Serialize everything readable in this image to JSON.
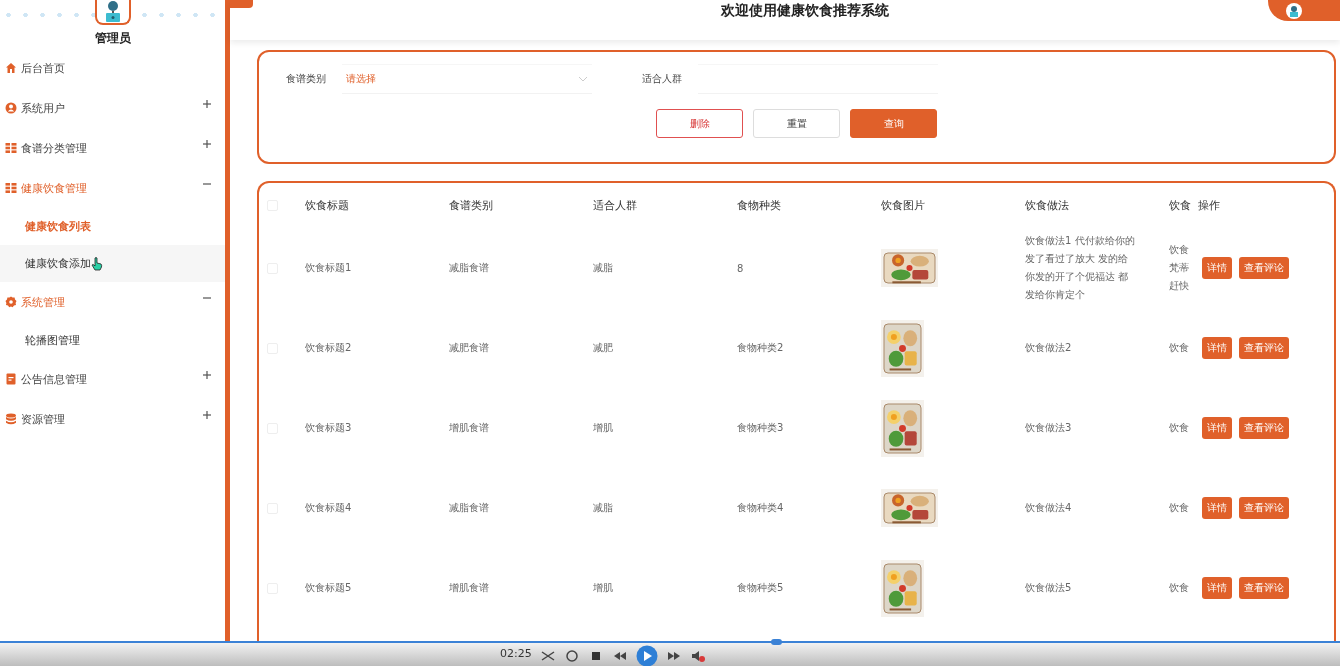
{
  "header": {
    "title": "欢迎使用健康饮食推荐系统"
  },
  "sidebar": {
    "user": "管理员",
    "items": [
      {
        "label": "后台首页",
        "kind": "home"
      },
      {
        "label": "系统用户",
        "kind": "user",
        "expanded": false
      },
      {
        "label": "食谱分类管理",
        "kind": "grid",
        "expanded": false
      },
      {
        "label": "健康饮食管理",
        "kind": "grid",
        "expanded": true,
        "children": [
          {
            "label": "健康饮食列表",
            "selected": true,
            "hovered": false
          },
          {
            "label": "健康饮食添加",
            "selected": false,
            "hovered": true
          }
        ]
      },
      {
        "label": "系统管理",
        "kind": "gear",
        "expanded": true,
        "children": [
          {
            "label": "轮播图管理",
            "selected": false,
            "hovered": false
          }
        ]
      },
      {
        "label": "公告信息管理",
        "kind": "doc",
        "expanded": false
      },
      {
        "label": "资源管理",
        "kind": "db",
        "expanded": false
      }
    ]
  },
  "search": {
    "fields": [
      {
        "kind": "select",
        "label": "食谱类别",
        "placeholder": "请选择"
      },
      {
        "kind": "input",
        "label": "适合人群"
      }
    ],
    "buttons": [
      {
        "label": "删除",
        "kind": "danger"
      },
      {
        "label": "重置",
        "kind": "default"
      },
      {
        "label": "查询",
        "kind": "primary"
      }
    ]
  },
  "table": {
    "all_checked": false,
    "columns": [
      "饮食标题",
      "食谱类别",
      "适合人群",
      "食物种类",
      "饮食图片",
      "饮食做法",
      "饮食",
      "操作"
    ],
    "rows": [
      {
        "checked": false,
        "title": "饮食标题1",
        "category": "减脂食谱",
        "crowd": "减脂",
        "food": "8",
        "picture": {
          "kind": "picture"
        },
        "method": "饮食做法1 代付款给你的发了看过了放大 发的给你发的开了个伲福达 都发给你肯定个",
        "column_7": "饮食梵蒂赶快",
        "actions": [
          "详情",
          "查看评论"
        ]
      },
      {
        "checked": false,
        "title": "饮食标题2",
        "category": "减肥食谱",
        "crowd": "减肥",
        "food": "食物种类2",
        "picture": {
          "kind": "picture"
        },
        "method": "饮食做法2",
        "column_7": "饮食",
        "actions": [
          "详情",
          "查看评论"
        ]
      },
      {
        "checked": false,
        "title": "饮食标题3",
        "category": "增肌食谱",
        "crowd": "增肌",
        "food": "食物种类3",
        "picture": {
          "kind": "picture"
        },
        "method": "饮食做法3",
        "column_7": "饮食",
        "actions": [
          "详情",
          "查看评论"
        ]
      },
      {
        "checked": false,
        "title": "饮食标题4",
        "category": "减脂食谱",
        "crowd": "减脂",
        "food": "食物种类4",
        "picture": {
          "kind": "picture"
        },
        "method": "饮食做法4",
        "column_7": "饮食",
        "actions": [
          "详情",
          "查看评论"
        ]
      },
      {
        "checked": false,
        "title": "饮食标题5",
        "category": "增肌食谱",
        "crowd": "增肌",
        "food": "食物种类5",
        "picture": {
          "kind": "picture"
        },
        "method": "饮食做法5",
        "column_7": "饮食",
        "actions": [
          "详情",
          "查看评论"
        ]
      }
    ]
  },
  "player": {
    "time": "02:25",
    "level": 0.58
  }
}
